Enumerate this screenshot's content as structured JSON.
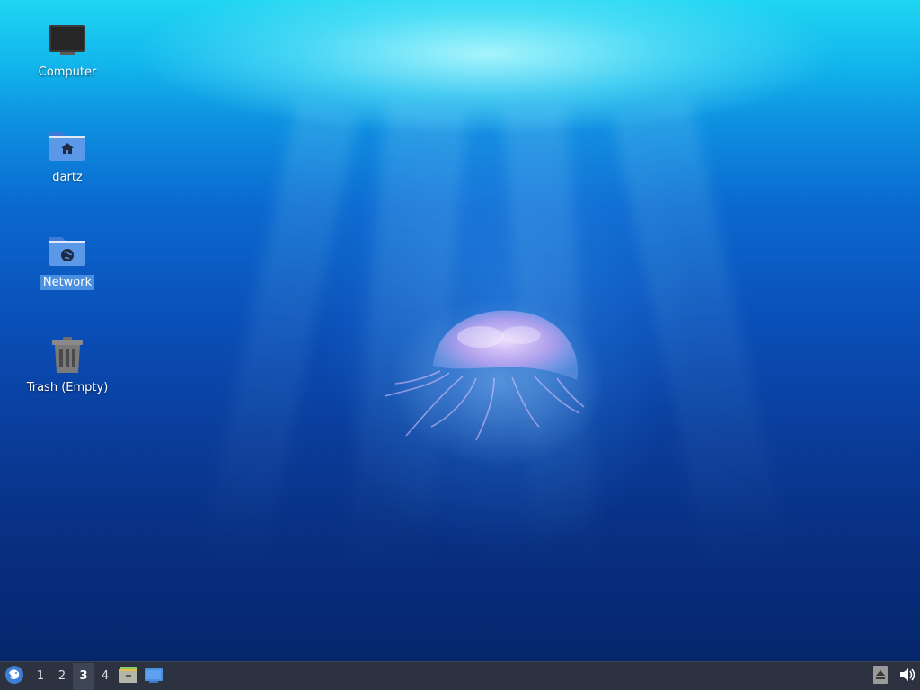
{
  "desktop": {
    "icons": [
      {
        "label": "Computer",
        "icon": "computer-icon"
      },
      {
        "label": "dartz",
        "icon": "home-folder-icon"
      },
      {
        "label": "Network",
        "icon": "network-folder-icon",
        "selected": true
      },
      {
        "label": "Trash (Empty)",
        "icon": "trash-icon"
      }
    ],
    "wallpaper": "underwater jellyfish",
    "selection_color": "#4a8fe0"
  },
  "taskbar": {
    "menu_icon": "xfce-mouse-icon",
    "workspaces": [
      {
        "label": "1",
        "active": false
      },
      {
        "label": "2",
        "active": false
      },
      {
        "label": "3",
        "active": true
      },
      {
        "label": "4",
        "active": false
      }
    ],
    "launchers": [
      {
        "name": "file-manager",
        "icon": "file-cabinet-icon"
      },
      {
        "name": "show-desktop",
        "icon": "show-desktop-icon"
      }
    ],
    "tray": [
      {
        "name": "eject",
        "icon": "eject-icon"
      },
      {
        "name": "volume",
        "icon": "volume-icon"
      }
    ],
    "background": "#2d3240"
  }
}
